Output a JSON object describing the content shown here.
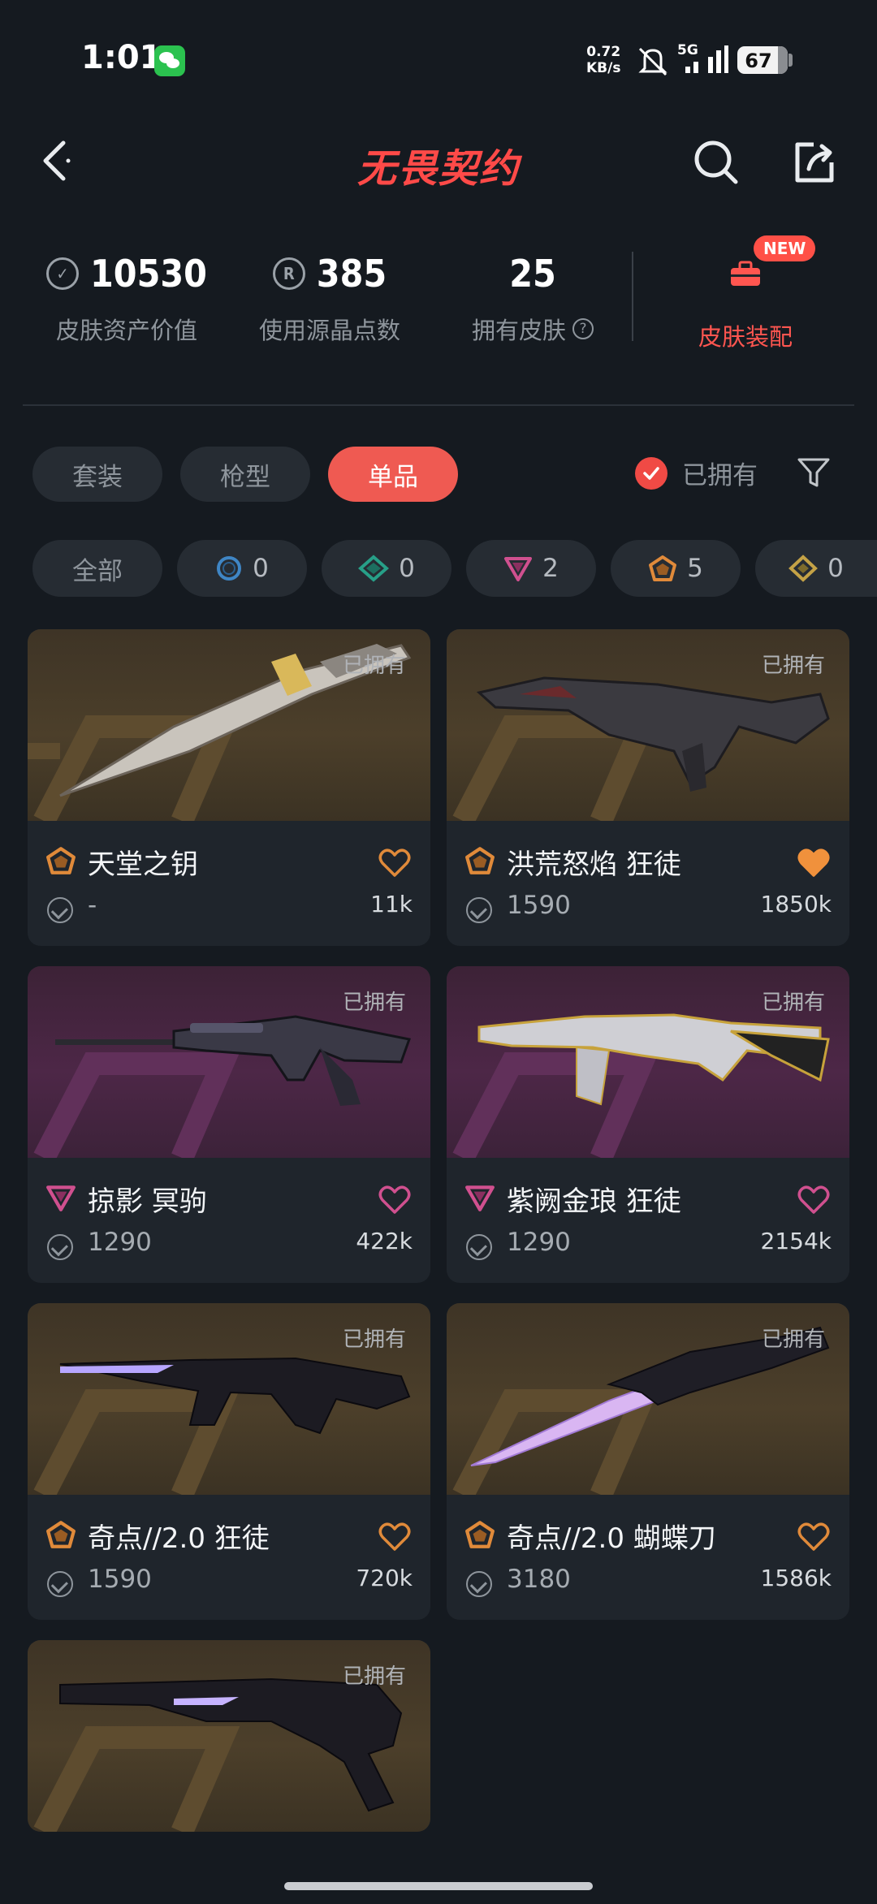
{
  "status_bar": {
    "time": "1:01",
    "net_speed_value": "0.72",
    "net_speed_unit": "KB/s",
    "signal": "5G",
    "battery": "67"
  },
  "header": {
    "title": "无畏契约"
  },
  "stats": [
    {
      "value": "10530",
      "label": "皮肤资产价值",
      "icon": "vp-coin"
    },
    {
      "value": "385",
      "label": "使用源晶点数",
      "icon": "radianite-coin"
    },
    {
      "value": "25",
      "label": "拥有皮肤",
      "icon": "help-icon"
    }
  ],
  "loadout": {
    "badge": "NEW",
    "label": "皮肤装配"
  },
  "tabs": [
    {
      "label": "套装",
      "active": false
    },
    {
      "label": "枪型",
      "active": false
    },
    {
      "label": "单品",
      "active": true
    }
  ],
  "owned_filter": {
    "label": "已拥有",
    "checked": true
  },
  "rarity_chips": [
    {
      "label": "全部"
    },
    {
      "icon": "select-tier-icon",
      "count": "0",
      "color": "#3f86c5"
    },
    {
      "icon": "deluxe-tier-icon",
      "count": "0",
      "color": "#27a088"
    },
    {
      "icon": "premium-tier-icon",
      "count": "2",
      "color": "#d0508f"
    },
    {
      "icon": "exclusive-tier-icon",
      "count": "5",
      "color": "#e08a3a"
    },
    {
      "icon": "ultra-tier-icon",
      "count": "0",
      "color": "#c4a246"
    }
  ],
  "cards": [
    {
      "name": "天堂之钥",
      "price": "-",
      "likes": "11k",
      "owned": "已拥有",
      "tier": "exclusive",
      "liked": false,
      "bg": "gold"
    },
    {
      "name": "洪荒怒焰 狂徒",
      "price": "1590",
      "likes": "1850k",
      "owned": "已拥有",
      "tier": "exclusive",
      "liked": true,
      "bg": "gold"
    },
    {
      "name": "掠影 冥驹",
      "price": "1290",
      "likes": "422k",
      "owned": "已拥有",
      "tier": "premium",
      "liked": false,
      "bg": "purple"
    },
    {
      "name": "紫阙金琅 狂徒",
      "price": "1290",
      "likes": "2154k",
      "owned": "已拥有",
      "tier": "premium",
      "liked": false,
      "bg": "purple"
    },
    {
      "name": "奇点//2.0 狂徒",
      "price": "1590",
      "likes": "720k",
      "owned": "已拥有",
      "tier": "exclusive",
      "liked": false,
      "bg": "gold"
    },
    {
      "name": "奇点//2.0 蝴蝶刀",
      "price": "3180",
      "likes": "1586k",
      "owned": "已拥有",
      "tier": "exclusive",
      "liked": false,
      "bg": "gold"
    },
    {
      "name": "",
      "price": "",
      "likes": "",
      "owned": "已拥有",
      "tier": "exclusive",
      "liked": false,
      "bg": "gold"
    }
  ],
  "colors": {
    "accent": "#ef5a52",
    "exclusive": "#e08a3a",
    "premium": "#d0508f",
    "background": "#151a20"
  }
}
